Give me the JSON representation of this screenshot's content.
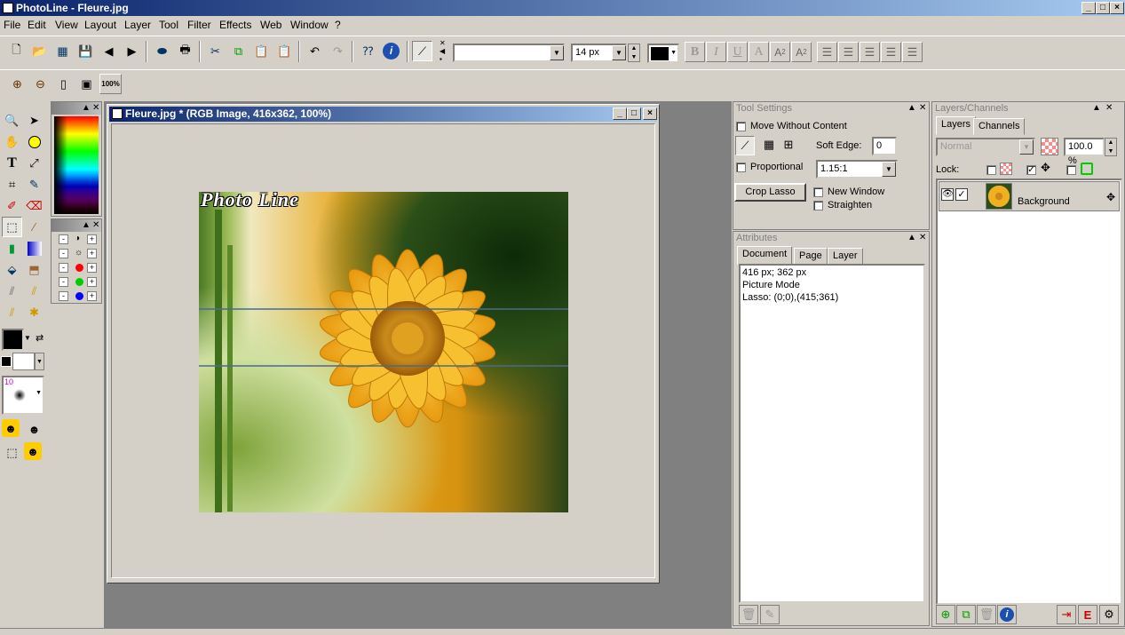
{
  "app": {
    "title": "PhotoLine - Fleure.jpg"
  },
  "menu": {
    "file": "File",
    "edit": "Edit",
    "view": "View",
    "layout": "Layout",
    "layer": "Layer",
    "tool": "Tool",
    "filter": "Filter",
    "effects": "Effects",
    "web": "Web",
    "window": "Window",
    "help": "?"
  },
  "toolbar": {
    "font_size": "14 px",
    "font_name": "",
    "zoom_100": "100%",
    "bold": "B",
    "italic": "I",
    "underline": "U",
    "outline": "A",
    "subscript": "A2",
    "superscript": "A2"
  },
  "toolbox": {
    "brush_size": "10"
  },
  "document": {
    "title": "Fleure.jpg * (RGB Image, 416x362, 100%)",
    "watermark": "Photo Line"
  },
  "tool_settings": {
    "title": "Tool Settings",
    "move_without_content": "Move Without Content",
    "soft_edge_label": "Soft Edge:",
    "soft_edge_value": "0",
    "proportional": "Proportional",
    "ratio_value": "1.15:1",
    "crop_lasso": "Crop Lasso",
    "new_window": "New Window",
    "straighten": "Straighten"
  },
  "attributes": {
    "title": "Attributes",
    "tabs": [
      "Document",
      "Page",
      "Layer"
    ],
    "lines": [
      "416 px; 362 px",
      "Picture Mode",
      "Lasso: (0;0),(415;361)"
    ]
  },
  "layers": {
    "title": "Layers/Channels",
    "tabs": [
      "Layers",
      "Channels"
    ],
    "blend_mode": "Normal",
    "opacity": "100.0 %",
    "lock_label": "Lock:",
    "items": [
      {
        "name": "Background"
      }
    ]
  },
  "colors": {
    "title_start": "#0a246a",
    "title_end": "#a6caf0",
    "chrome": "#d4d0c8",
    "workspace": "#808080"
  }
}
